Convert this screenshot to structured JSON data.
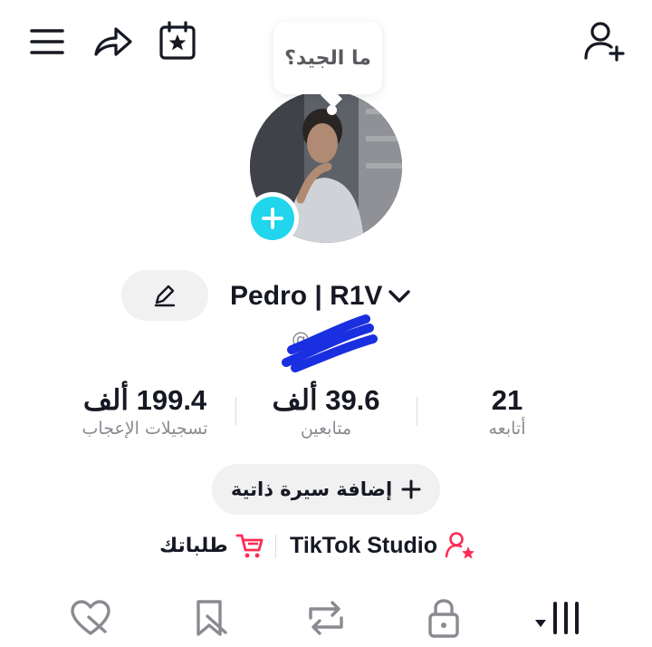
{
  "header": {
    "menu_icon": "hamburger-menu-icon",
    "share_icon": "share-arrow-icon",
    "calendar_icon": "calendar-star-icon",
    "add_friend_icon": "add-user-icon"
  },
  "prompt_bubble": {
    "text": "ما الجيد؟"
  },
  "profile": {
    "display_name": "Pedro | R1V",
    "username": "@",
    "avatar_icon": "profile-photo",
    "add_icon": "plus-icon",
    "edit_icon": "pencil-icon",
    "dropdown_icon": "chevron-down-icon"
  },
  "stats": {
    "likes": {
      "value": "199.4 ألف",
      "label": "تسجيلات الإعجاب"
    },
    "followers": {
      "value": "39.6 ألف",
      "label": "متابعين"
    },
    "following": {
      "value": "21",
      "label": "أتابعه"
    }
  },
  "bio_button": {
    "label": "إضافة سيرة ذاتية",
    "icon": "plus-icon"
  },
  "links": {
    "studio": {
      "label": "TikTok Studio",
      "icon": "creator-star-icon"
    },
    "orders": {
      "label": "طلباتك",
      "icon": "shopping-cart-icon"
    }
  },
  "tabs": [
    {
      "name": "videos",
      "icon": "grid-icon"
    },
    {
      "name": "private",
      "icon": "lock-icon"
    },
    {
      "name": "reposts",
      "icon": "repost-icon"
    },
    {
      "name": "favorites",
      "icon": "bookmark-icon"
    },
    {
      "name": "liked",
      "icon": "heart-icon"
    }
  ],
  "colors": {
    "accent_cyan": "#20d5ec",
    "accent_red": "#fe2c55",
    "text": "#161823",
    "muted": "#8a8b91"
  }
}
